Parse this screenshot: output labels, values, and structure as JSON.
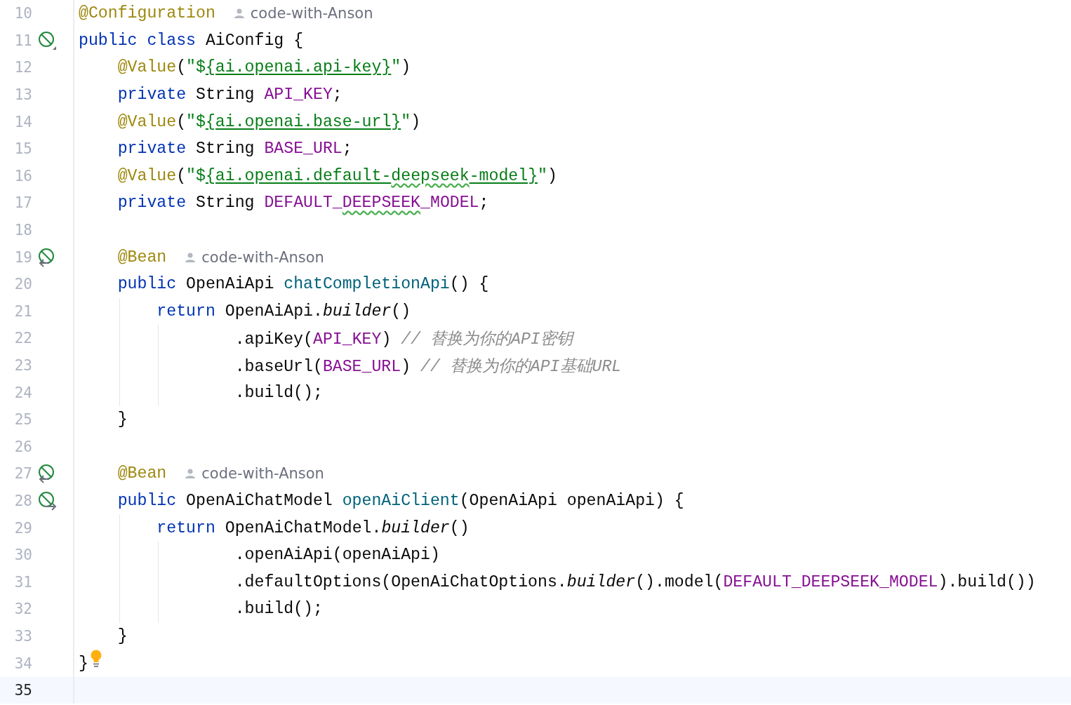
{
  "editor": {
    "lines": [
      {
        "number": "10",
        "current": false,
        "code": [
          {
            "kind": "annotation",
            "text": "@Configuration"
          }
        ],
        "author": "code-with-Anson"
      },
      {
        "number": "11",
        "current": false,
        "gutter": {
          "kind": "bean_class"
        },
        "code": [
          {
            "kind": "keyword",
            "text": "public class "
          },
          {
            "kind": "plain",
            "text": "AiConfig {"
          }
        ]
      },
      {
        "number": "12",
        "current": false,
        "code": [
          {
            "kind": "annotation",
            "text": "    @Value"
          },
          {
            "kind": "plain",
            "text": "("
          },
          {
            "kind": "string",
            "text": "\"$"
          },
          {
            "kind": "link",
            "text": "{ai.openai.api-key}"
          },
          {
            "kind": "string",
            "text": "\""
          },
          {
            "kind": "plain",
            "text": ")"
          }
        ]
      },
      {
        "number": "13",
        "current": false,
        "code": [
          {
            "kind": "keyword",
            "text": "    private "
          },
          {
            "kind": "plain",
            "text": "String "
          },
          {
            "kind": "field",
            "text": "API_KEY"
          },
          {
            "kind": "plain",
            "text": ";"
          }
        ]
      },
      {
        "number": "14",
        "current": false,
        "code": [
          {
            "kind": "annotation",
            "text": "    @Value"
          },
          {
            "kind": "plain",
            "text": "("
          },
          {
            "kind": "string",
            "text": "\"$"
          },
          {
            "kind": "link",
            "text": "{ai.openai.base-url}"
          },
          {
            "kind": "string",
            "text": "\""
          },
          {
            "kind": "plain",
            "text": ")"
          }
        ]
      },
      {
        "number": "15",
        "current": false,
        "code": [
          {
            "kind": "keyword",
            "text": "    private "
          },
          {
            "kind": "plain",
            "text": "String "
          },
          {
            "kind": "field",
            "text": "BASE_URL"
          },
          {
            "kind": "plain",
            "text": ";"
          }
        ]
      },
      {
        "number": "16",
        "current": false,
        "code": [
          {
            "kind": "annotation",
            "text": "    @Value"
          },
          {
            "kind": "plain",
            "text": "("
          },
          {
            "kind": "string",
            "text": "\"$"
          },
          {
            "kind": "link",
            "text": "{ai.openai.default-"
          },
          {
            "kind": "link",
            "text": "deepseek",
            "typo": true
          },
          {
            "kind": "link",
            "text": "-model}"
          },
          {
            "kind": "string",
            "text": "\""
          },
          {
            "kind": "plain",
            "text": ")"
          }
        ]
      },
      {
        "number": "17",
        "current": false,
        "code": [
          {
            "kind": "keyword",
            "text": "    private "
          },
          {
            "kind": "plain",
            "text": "String "
          },
          {
            "kind": "field",
            "text": "DEFAULT_"
          },
          {
            "kind": "field",
            "text": "DEEPSEEK",
            "typo": true
          },
          {
            "kind": "field",
            "text": "_MODEL"
          },
          {
            "kind": "plain",
            "text": ";"
          }
        ]
      },
      {
        "number": "18",
        "current": false
      },
      {
        "number": "19",
        "current": false,
        "gutter": {
          "kind": "bean_in"
        },
        "code": [
          {
            "kind": "annotation",
            "text": "    @Bean"
          }
        ],
        "author": "code-with-Anson"
      },
      {
        "number": "20",
        "current": false,
        "code": [
          {
            "kind": "keyword",
            "text": "    public "
          },
          {
            "kind": "plain",
            "text": "OpenAiApi "
          },
          {
            "kind": "method",
            "text": "chatCompletionApi"
          },
          {
            "kind": "plain",
            "text": "() {"
          }
        ]
      },
      {
        "number": "21",
        "current": false,
        "code": [
          {
            "kind": "keyword",
            "text": "        return "
          },
          {
            "kind": "plain",
            "text": "OpenAiApi."
          },
          {
            "kind": "static_call",
            "text": "builder"
          },
          {
            "kind": "plain",
            "text": "()"
          }
        ]
      },
      {
        "number": "22",
        "current": false,
        "code": [
          {
            "kind": "plain",
            "text": "                .apiKey("
          },
          {
            "kind": "field",
            "text": "API_KEY"
          },
          {
            "kind": "plain",
            "text": ") "
          },
          {
            "kind": "comment",
            "text": "// 替换为你的API密钥"
          }
        ]
      },
      {
        "number": "23",
        "current": false,
        "code": [
          {
            "kind": "plain",
            "text": "                .baseUrl("
          },
          {
            "kind": "field",
            "text": "BASE_URL"
          },
          {
            "kind": "plain",
            "text": ") "
          },
          {
            "kind": "comment",
            "text": "// 替换为你的API基础URL"
          }
        ]
      },
      {
        "number": "24",
        "current": false,
        "code": [
          {
            "kind": "plain",
            "text": "                .build();"
          }
        ]
      },
      {
        "number": "25",
        "current": false,
        "code": [
          {
            "kind": "plain",
            "text": "    }"
          }
        ]
      },
      {
        "number": "26",
        "current": false
      },
      {
        "number": "27",
        "current": false,
        "gutter": {
          "kind": "bean_in"
        },
        "code": [
          {
            "kind": "annotation",
            "text": "    @Bean"
          }
        ],
        "author": "code-with-Anson"
      },
      {
        "number": "28",
        "current": false,
        "gutter": {
          "kind": "bean_out"
        },
        "code": [
          {
            "kind": "keyword",
            "text": "    public "
          },
          {
            "kind": "plain",
            "text": "OpenAiChatModel "
          },
          {
            "kind": "method",
            "text": "openAiClient"
          },
          {
            "kind": "plain",
            "text": "(OpenAiApi openAiApi) {"
          }
        ]
      },
      {
        "number": "29",
        "current": false,
        "code": [
          {
            "kind": "keyword",
            "text": "        return "
          },
          {
            "kind": "plain",
            "text": "OpenAiChatModel."
          },
          {
            "kind": "static_call",
            "text": "builder"
          },
          {
            "kind": "plain",
            "text": "()"
          }
        ]
      },
      {
        "number": "30",
        "current": false,
        "code": [
          {
            "kind": "plain",
            "text": "                .openAiApi(openAiApi)"
          }
        ]
      },
      {
        "number": "31",
        "current": false,
        "code": [
          {
            "kind": "plain",
            "text": "                .defaultOptions(OpenAiChatOptions."
          },
          {
            "kind": "static_call",
            "text": "builder"
          },
          {
            "kind": "plain",
            "text": "().model("
          },
          {
            "kind": "field",
            "text": "DEFAULT_DEEPSEEK_MODEL"
          },
          {
            "kind": "plain",
            "text": ").build())"
          }
        ]
      },
      {
        "number": "32",
        "current": false,
        "code": [
          {
            "kind": "plain",
            "text": "                .build();"
          }
        ]
      },
      {
        "number": "33",
        "current": false,
        "code": [
          {
            "kind": "plain",
            "text": "    }"
          }
        ]
      },
      {
        "number": "34",
        "current": false,
        "code": [
          {
            "kind": "plain",
            "text": "}"
          }
        ],
        "bulb": true
      },
      {
        "number": "35",
        "current": true
      }
    ]
  }
}
